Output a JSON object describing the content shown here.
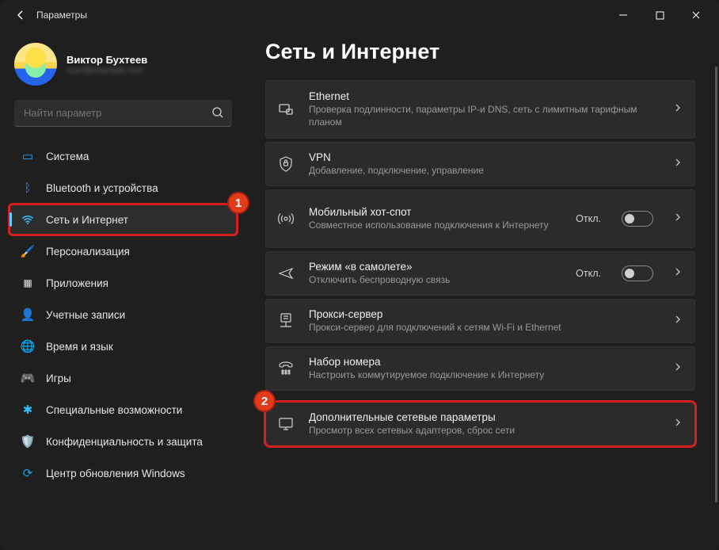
{
  "header": {
    "title": "Параметры"
  },
  "profile": {
    "name": "Виктор Бухтеев",
    "email": "user@example.com"
  },
  "search": {
    "placeholder": "Найти параметр"
  },
  "nav": {
    "items": [
      {
        "label": "Система",
        "icon": "🖥️"
      },
      {
        "label": "Bluetooth и устройства",
        "icon": "bt"
      },
      {
        "label": "Сеть и Интернет",
        "icon": "wifi"
      },
      {
        "label": "Персонализация",
        "icon": "🖌️"
      },
      {
        "label": "Приложения",
        "icon": "apps"
      },
      {
        "label": "Учетные записи",
        "icon": "👤"
      },
      {
        "label": "Время и язык",
        "icon": "🌐"
      },
      {
        "label": "Игры",
        "icon": "🎮"
      },
      {
        "label": "Специальные возможности",
        "icon": "acc"
      },
      {
        "label": "Конфиденциальность и защита",
        "icon": "🛡️"
      },
      {
        "label": "Центр обновления Windows",
        "icon": "🔄"
      }
    ]
  },
  "page": {
    "title": "Сеть и Интернет"
  },
  "status": {
    "off": "Откл."
  },
  "cards": {
    "ethernet": {
      "title": "Ethernet",
      "desc": "Проверка подлинности, параметры IP-и DNS, сеть с лимитным тарифным планом"
    },
    "vpn": {
      "title": "VPN",
      "desc": "Добавление, подключение, управление"
    },
    "hotspot": {
      "title": "Мобильный хот-спот",
      "desc": "Совместное использование подключения к Интернету"
    },
    "airplane": {
      "title": "Режим «в самолете»",
      "desc": "Отключить беспроводную связь"
    },
    "proxy": {
      "title": "Прокси-сервер",
      "desc": "Прокси-сервер для подключений к сетям Wi-Fi и Ethernet"
    },
    "dialup": {
      "title": "Набор номера",
      "desc": "Настроить коммутируемое подключение к Интернету"
    },
    "advanced": {
      "title": "Дополнительные сетевые параметры",
      "desc": "Просмотр всех сетевых адаптеров, сброс сети"
    }
  },
  "badges": {
    "one": "1",
    "two": "2"
  }
}
